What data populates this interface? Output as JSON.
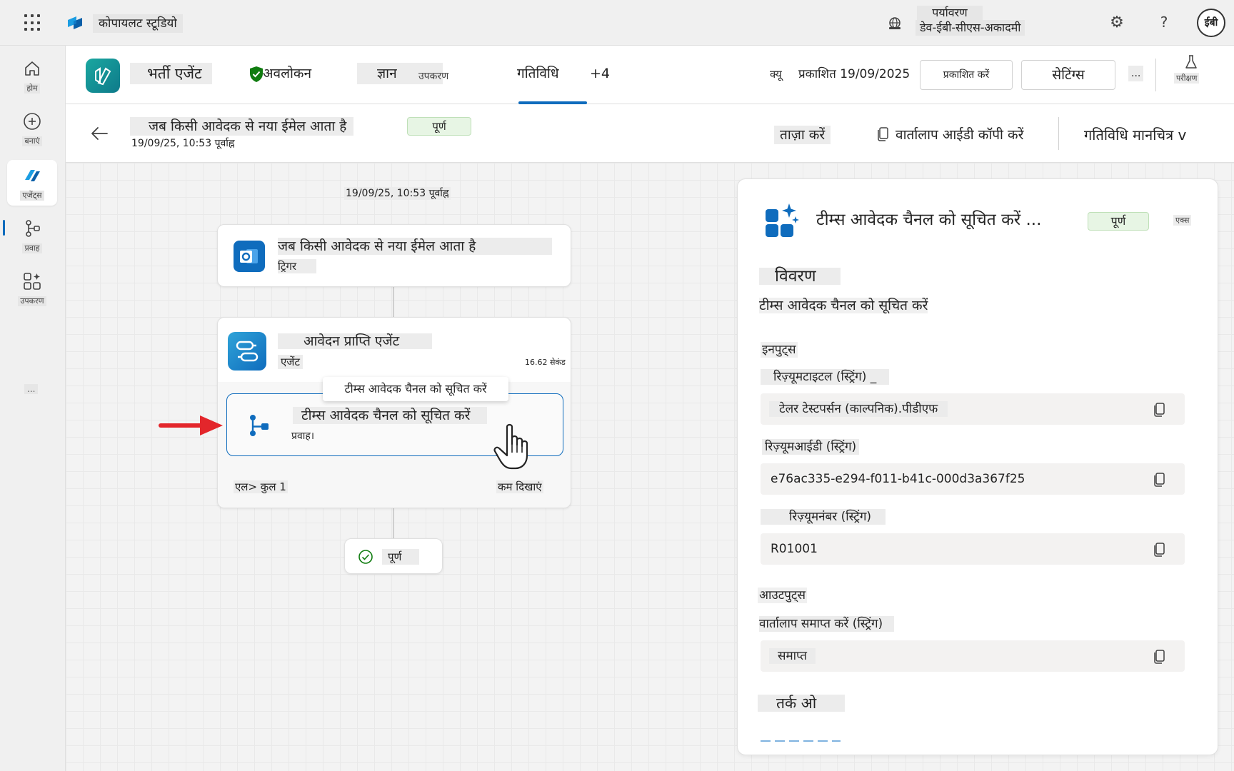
{
  "app": {
    "name": "कोपायलट स्टूडियो",
    "environment_label": "पर्यावरण",
    "environment_value": "डेव-ईबी-सीएस-अकादमी",
    "user_initials": "ईबी",
    "help_label": "?"
  },
  "rail": {
    "items": [
      {
        "label": "होम",
        "icon": "home-icon"
      },
      {
        "label": "बनाएं",
        "icon": "create-icon"
      },
      {
        "label": "एजेंट्स",
        "icon": "agents-icon",
        "active": true
      },
      {
        "label": "प्रवाह",
        "icon": "flows-icon"
      },
      {
        "label": "उपकरण",
        "icon": "tools-icon"
      }
    ],
    "more": "..."
  },
  "agent_header": {
    "agent_name": "भर्ती एजेंट",
    "tabs": [
      {
        "label": "अवलोकन"
      },
      {
        "label": "ज्ञान"
      },
      {
        "label": "उपकरण"
      },
      {
        "label": "गतिविधि",
        "selected": true
      },
      {
        "label": "+4"
      }
    ],
    "publish_why": "क्यू",
    "published": "प्रकाशित 19/09/2025",
    "publish_button": "प्रकाशित करें",
    "settings_button": "सेटिंग्स",
    "more_button": "...",
    "test_label": "परीक्षण"
  },
  "run_header": {
    "title": "जब किसी आवेदक से नया ईमेल आता है",
    "status": "पूर्ण",
    "timestamp": "19/09/25, 10:53 पूर्वाह्न",
    "refresh": "ताज़ा करें",
    "copy_conversation": "वार्तालाप आईडी कॉपी करें",
    "activity_map": "गतिविधि मानचित्र v"
  },
  "canvas": {
    "timestamp": "19/09/25, 10:53 पूर्वाह्न",
    "trigger": {
      "title": "जब किसी आवेदक से नया ईमेल आता है",
      "subtitle": "ट्रिगर"
    },
    "agent": {
      "title": "आवेदन प्राप्ति एजेंट",
      "subtitle": "एजेंट",
      "duration": "16.62 सेकंड",
      "total": "एल> कुल 1",
      "show_less": "कम दिखाएं"
    },
    "flow": {
      "title": "टीम्स आवेदक चैनल को सूचित करें",
      "subtitle": "प्रवाह।",
      "tooltip": "टीम्स आवेदक चैनल को सूचित करें"
    },
    "done": "पूर्ण"
  },
  "panel": {
    "title": "टीम्स आवेदक चैनल को सूचित करें ...",
    "status": "पूर्ण",
    "close_label": "एक्स",
    "description_heading": "विवरण",
    "description": "टीम्स आवेदक चैनल को सूचित करें",
    "inputs_heading": "इनपुट्स",
    "inputs": [
      {
        "label": "रिज़्यूमटाइटल (स्ट्रिंग) _",
        "value": "टेलर टेस्टपर्सन (काल्पनिक).पीडीएफ"
      },
      {
        "label": "रिज़्यूमआईडी (स्ट्रिंग)",
        "value": "e76ac335-e294-f011-b41c-000d3a367f25"
      },
      {
        "label": "रिज़्यूमनंबर (स्ट्रिंग)",
        "value": "R01001"
      }
    ],
    "outputs_heading": "आउटपुट्स",
    "outputs": [
      {
        "label": "वार्तालाप समाप्त करें (स्ट्रिंग)",
        "value": "समाप्त"
      }
    ],
    "logic_heading": "तर्क ओ"
  },
  "colors": {
    "accent": "#0f6cbd",
    "success_bg": "#e7f5e4",
    "shield_green": "#107c10",
    "arrow_red": "#e3262b"
  }
}
